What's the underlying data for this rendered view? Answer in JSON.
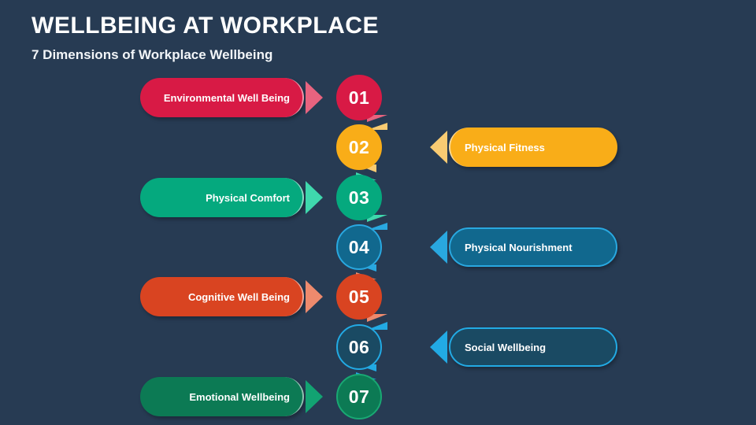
{
  "header": {
    "title": "WELLBEING AT WORKPLACE",
    "subtitle": "7 Dimensions of Workplace Wellbeing"
  },
  "theme": {
    "background": "#273b53",
    "text": "#ffffff"
  },
  "items": [
    {
      "number": "01",
      "label": "Environmental Well Being",
      "side": "left",
      "fill": "#d81a45",
      "accent": "#e8637f",
      "circle_fill": "#d81a45",
      "circle_ring": "#d81a45",
      "connector": "#e8637f"
    },
    {
      "number": "02",
      "label": "Physical Fitness",
      "side": "right",
      "fill": "#f9ad18",
      "accent": "#f9cb72",
      "circle_fill": "#f9ad18",
      "circle_ring": "#f9ad18",
      "connector": "#f9cb72"
    },
    {
      "number": "03",
      "label": "Physical Comfort",
      "side": "left",
      "fill": "#05a97e",
      "accent": "#3fd8ad",
      "circle_fill": "#05a97e",
      "circle_ring": "#05a97e",
      "connector": "#3fd8ad"
    },
    {
      "number": "04",
      "label": "Physical Nourishment",
      "side": "right",
      "fill": "#11688e",
      "accent": "#29a8e0",
      "circle_fill": "#11688e",
      "circle_ring": "#29a8e0",
      "connector": "#29a8e0"
    },
    {
      "number": "05",
      "label": "Cognitive Well Being",
      "side": "left",
      "fill": "#d94421",
      "accent": "#ed8a6d",
      "circle_fill": "#d94421",
      "circle_ring": "#d94421",
      "connector": "#ed8a6d"
    },
    {
      "number": "06",
      "label": "Social Wellbeing",
      "side": "right",
      "fill": "#1a4a63",
      "accent": "#22aae4",
      "circle_fill": "#1a4a63",
      "circle_ring": "#22aae4",
      "connector": "#22aae4"
    },
    {
      "number": "07",
      "label": "Emotional Wellbeing",
      "side": "left",
      "fill": "#0c7a54",
      "accent": "#12a372",
      "circle_fill": "#0c7a54",
      "circle_ring": "#19a873",
      "connector": "#22aae4"
    }
  ]
}
